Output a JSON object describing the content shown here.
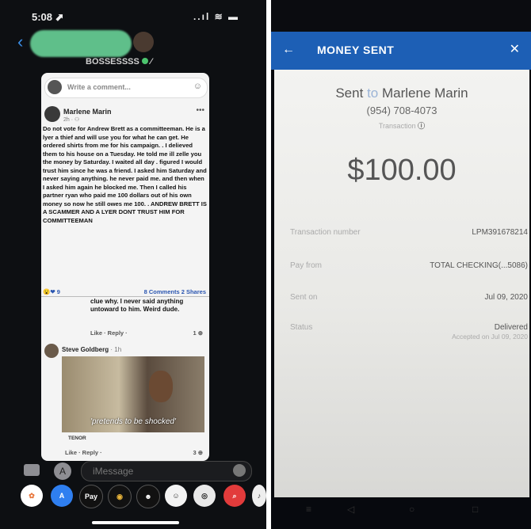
{
  "left_phone": {
    "status": {
      "time": "5:08 ⬈",
      "icons": "..ıl ≋ ▬"
    },
    "contact_status": "BOSSESSSS",
    "comment_placeholder": "Write a comment...",
    "post": {
      "author": "Marlene Marin",
      "time": "2h · ⚇",
      "body": "Do not vote for Andrew Brett  as a committeeman. He is a lyer a thief and will use you for what he can get. He ordered shirts from me for his campaign. . I delieved them to his house   on a Tuesday. He told me ill zelle you the money by Saturday. I waited all day . figured I would trust him since he was a friend. I asked him Saturday and never saying anything. he never paid me.  and then when I asked him again he blocked me. Then I called his partner ryan who  paid me 100 dollars out of his own money  so now he still owes me 100. . ANDREW BRETT IS A SCAMMER AND A LYER DONT TRUST HIM FOR COMMITTEEMAN",
      "reactions": "😮❤ 9",
      "counts": "8 Comments  2 Shares"
    },
    "reply": {
      "text": "clue why. I never said anything untoward to him. Weird dude.",
      "actions": "Like · Reply ·",
      "likes": "1 ⊕"
    },
    "comment2": {
      "author": "Steve Goldberg",
      "time": "· 1h",
      "gif_caption": "'pretends to be shocked'",
      "gif_source": "TENOR",
      "actions": "Like · Reply ·",
      "likes": "3 ⊕"
    },
    "message_placeholder": "iMessage",
    "dock_apps": [
      "Photos",
      "App Store",
      "Apple Pay",
      "Memoji",
      "Emoji",
      "Music",
      "Search",
      "More"
    ]
  },
  "right_phone": {
    "header_title": "MONEY SENT",
    "sent_prefix": "Sent",
    "sent_to_word": "to",
    "recipient": "Marlene Marin",
    "phone": "(954) 708-4073",
    "info_label": "Transaction",
    "amount": "$100.00",
    "rows": [
      {
        "label": "Transaction number",
        "value": "LPM391678214"
      },
      {
        "label": "Pay from",
        "value": "TOTAL CHECKING(...5086)"
      },
      {
        "label": "Sent on",
        "value": "Jul 09, 2020"
      },
      {
        "label": "Status",
        "value": "Delivered",
        "sub": "Accepted on Jul 09, 2020"
      }
    ]
  },
  "colors": {
    "chase_blue": "#1d5fb5",
    "imessage_blue": "#3b8fe8",
    "fb_link": "#2a55b0"
  }
}
